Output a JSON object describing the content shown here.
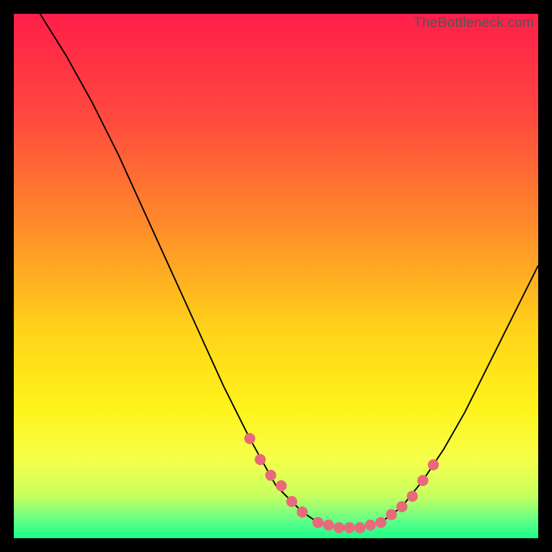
{
  "watermark": "TheBottleneck.com",
  "colors": {
    "dot": "#e86a7a",
    "curve": "#000000",
    "bg_black": "#000000"
  },
  "chart_data": {
    "type": "line",
    "title": "",
    "xlabel": "",
    "ylabel": "",
    "xlim": [
      0,
      100
    ],
    "ylim": [
      0,
      100
    ],
    "gradient_stops": [
      {
        "offset": 0.0,
        "color": "#ff1e4a"
      },
      {
        "offset": 0.2,
        "color": "#ff4a3e"
      },
      {
        "offset": 0.4,
        "color": "#ff8a2a"
      },
      {
        "offset": 0.6,
        "color": "#ffd21a"
      },
      {
        "offset": 0.75,
        "color": "#fff31a"
      },
      {
        "offset": 0.85,
        "color": "#f6ff4a"
      },
      {
        "offset": 0.92,
        "color": "#c6ff60"
      },
      {
        "offset": 0.97,
        "color": "#5aff8a"
      },
      {
        "offset": 1.0,
        "color": "#1aff8a"
      }
    ],
    "curve": [
      {
        "x": 5,
        "y": 100
      },
      {
        "x": 10,
        "y": 92
      },
      {
        "x": 15,
        "y": 83
      },
      {
        "x": 20,
        "y": 73
      },
      {
        "x": 25,
        "y": 62
      },
      {
        "x": 30,
        "y": 51
      },
      {
        "x": 35,
        "y": 40
      },
      {
        "x": 40,
        "y": 29
      },
      {
        "x": 45,
        "y": 19
      },
      {
        "x": 50,
        "y": 10
      },
      {
        "x": 55,
        "y": 5
      },
      {
        "x": 58,
        "y": 3
      },
      {
        "x": 62,
        "y": 2
      },
      {
        "x": 66,
        "y": 2
      },
      {
        "x": 70,
        "y": 3
      },
      {
        "x": 74,
        "y": 6
      },
      {
        "x": 78,
        "y": 11
      },
      {
        "x": 82,
        "y": 17
      },
      {
        "x": 86,
        "y": 24
      },
      {
        "x": 90,
        "y": 32
      },
      {
        "x": 95,
        "y": 42
      },
      {
        "x": 100,
        "y": 52
      }
    ],
    "dots": [
      {
        "x": 45,
        "y": 19
      },
      {
        "x": 47,
        "y": 15
      },
      {
        "x": 49,
        "y": 12
      },
      {
        "x": 51,
        "y": 10
      },
      {
        "x": 53,
        "y": 7
      },
      {
        "x": 55,
        "y": 5
      },
      {
        "x": 58,
        "y": 3
      },
      {
        "x": 60,
        "y": 2.5
      },
      {
        "x": 62,
        "y": 2
      },
      {
        "x": 64,
        "y": 2
      },
      {
        "x": 66,
        "y": 2
      },
      {
        "x": 68,
        "y": 2.5
      },
      {
        "x": 70,
        "y": 3
      },
      {
        "x": 72,
        "y": 4.5
      },
      {
        "x": 74,
        "y": 6
      },
      {
        "x": 76,
        "y": 8
      },
      {
        "x": 78,
        "y": 11
      },
      {
        "x": 80,
        "y": 14
      }
    ]
  }
}
